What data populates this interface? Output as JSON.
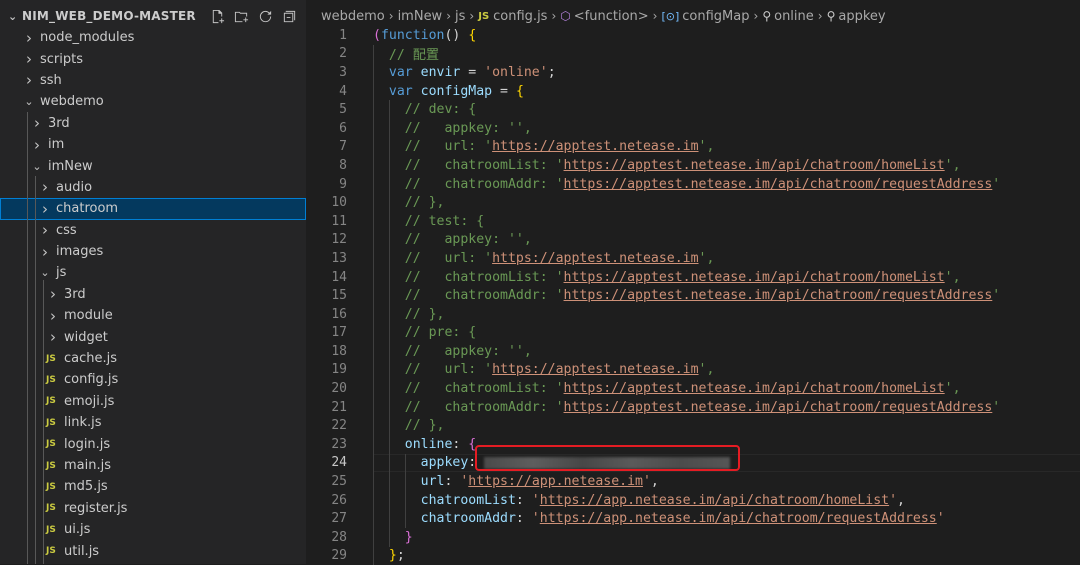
{
  "explorer": {
    "project": "NIM_WEB_DEMO-MASTER",
    "actions": [
      "new-file-icon",
      "new-folder-icon",
      "refresh-icon",
      "collapse-all-icon"
    ],
    "items": [
      {
        "label": "node_modules",
        "type": "folder",
        "expanded": false,
        "depth": 0
      },
      {
        "label": "scripts",
        "type": "folder",
        "expanded": false,
        "depth": 0
      },
      {
        "label": "ssh",
        "type": "folder",
        "expanded": false,
        "depth": 0
      },
      {
        "label": "webdemo",
        "type": "folder",
        "expanded": true,
        "depth": 0
      },
      {
        "label": "3rd",
        "type": "folder",
        "expanded": false,
        "depth": 1
      },
      {
        "label": "im",
        "type": "folder",
        "expanded": false,
        "depth": 1
      },
      {
        "label": "imNew",
        "type": "folder",
        "expanded": true,
        "depth": 1
      },
      {
        "label": "audio",
        "type": "folder",
        "expanded": false,
        "depth": 2
      },
      {
        "label": "chatroom",
        "type": "folder",
        "expanded": false,
        "depth": 2,
        "selected": true
      },
      {
        "label": "css",
        "type": "folder",
        "expanded": false,
        "depth": 2
      },
      {
        "label": "images",
        "type": "folder",
        "expanded": false,
        "depth": 2
      },
      {
        "label": "js",
        "type": "folder",
        "expanded": true,
        "depth": 2
      },
      {
        "label": "3rd",
        "type": "folder",
        "expanded": false,
        "depth": 3
      },
      {
        "label": "module",
        "type": "folder",
        "expanded": false,
        "depth": 3
      },
      {
        "label": "widget",
        "type": "folder",
        "expanded": false,
        "depth": 3
      },
      {
        "label": "cache.js",
        "type": "file",
        "depth": 3
      },
      {
        "label": "config.js",
        "type": "file",
        "depth": 3
      },
      {
        "label": "emoji.js",
        "type": "file",
        "depth": 3
      },
      {
        "label": "link.js",
        "type": "file",
        "depth": 3
      },
      {
        "label": "login.js",
        "type": "file",
        "depth": 3
      },
      {
        "label": "main.js",
        "type": "file",
        "depth": 3
      },
      {
        "label": "md5.js",
        "type": "file",
        "depth": 3
      },
      {
        "label": "register.js",
        "type": "file",
        "depth": 3
      },
      {
        "label": "ui.js",
        "type": "file",
        "depth": 3
      },
      {
        "label": "util.js",
        "type": "file",
        "depth": 3
      }
    ]
  },
  "breadcrumb": {
    "segments": [
      "webdemo",
      "imNew",
      "js",
      "config.js",
      "<function>",
      "configMap",
      "online",
      "appkey"
    ],
    "file_badge": "JS"
  },
  "editor": {
    "current_line": 24,
    "lines": [
      {
        "n": 1,
        "indent": 0,
        "tokens": [
          [
            "brk",
            "("
          ],
          [
            "kw",
            "function"
          ],
          [
            "pun",
            "() "
          ],
          [
            "brk2",
            "{"
          ]
        ]
      },
      {
        "n": 2,
        "indent": 1,
        "tokens": [
          [
            "cm",
            "// 配置"
          ]
        ]
      },
      {
        "n": 3,
        "indent": 1,
        "tokens": [
          [
            "kw",
            "var "
          ],
          [
            "var",
            "envir"
          ],
          [
            "pun",
            " = "
          ],
          [
            "str",
            "'online'"
          ],
          [
            "pun",
            ";"
          ]
        ]
      },
      {
        "n": 4,
        "indent": 1,
        "tokens": [
          [
            "kw",
            "var "
          ],
          [
            "var",
            "configMap"
          ],
          [
            "pun",
            " = "
          ],
          [
            "brk2",
            "{"
          ]
        ]
      },
      {
        "n": 5,
        "indent": 2,
        "tokens": [
          [
            "cm",
            "// dev: {"
          ]
        ]
      },
      {
        "n": 6,
        "indent": 2,
        "tokens": [
          [
            "cm",
            "//   appkey: '',"
          ]
        ]
      },
      {
        "n": 7,
        "indent": 2,
        "tokens": [
          [
            "cm",
            "//   url: '"
          ],
          [
            "cmurl",
            "https://apptest.netease.im"
          ],
          [
            "cm",
            "',"
          ]
        ]
      },
      {
        "n": 8,
        "indent": 2,
        "tokens": [
          [
            "cm",
            "//   chatroomList: '"
          ],
          [
            "cmurl",
            "https://apptest.netease.im/api/chatroom/homeList"
          ],
          [
            "cm",
            "',"
          ]
        ]
      },
      {
        "n": 9,
        "indent": 2,
        "tokens": [
          [
            "cm",
            "//   chatroomAddr: '"
          ],
          [
            "cmurl",
            "https://apptest.netease.im/api/chatroom/requestAddress"
          ],
          [
            "cm",
            "'"
          ]
        ]
      },
      {
        "n": 10,
        "indent": 2,
        "tokens": [
          [
            "cm",
            "// },"
          ]
        ]
      },
      {
        "n": 11,
        "indent": 2,
        "tokens": [
          [
            "cm",
            "// test: {"
          ]
        ]
      },
      {
        "n": 12,
        "indent": 2,
        "tokens": [
          [
            "cm",
            "//   appkey: '',"
          ]
        ]
      },
      {
        "n": 13,
        "indent": 2,
        "tokens": [
          [
            "cm",
            "//   url: '"
          ],
          [
            "cmurl",
            "https://apptest.netease.im"
          ],
          [
            "cm",
            "',"
          ]
        ]
      },
      {
        "n": 14,
        "indent": 2,
        "tokens": [
          [
            "cm",
            "//   chatroomList: '"
          ],
          [
            "cmurl",
            "https://apptest.netease.im/api/chatroom/homeList"
          ],
          [
            "cm",
            "',"
          ]
        ]
      },
      {
        "n": 15,
        "indent": 2,
        "tokens": [
          [
            "cm",
            "//   chatroomAddr: '"
          ],
          [
            "cmurl",
            "https://apptest.netease.im/api/chatroom/requestAddress"
          ],
          [
            "cm",
            "'"
          ]
        ]
      },
      {
        "n": 16,
        "indent": 2,
        "tokens": [
          [
            "cm",
            "// },"
          ]
        ]
      },
      {
        "n": 17,
        "indent": 2,
        "tokens": [
          [
            "cm",
            "// pre: {"
          ]
        ]
      },
      {
        "n": 18,
        "indent": 2,
        "tokens": [
          [
            "cm",
            "//   appkey: '',"
          ]
        ]
      },
      {
        "n": 19,
        "indent": 2,
        "tokens": [
          [
            "cm",
            "//   url: '"
          ],
          [
            "cmurl",
            "https://apptest.netease.im"
          ],
          [
            "cm",
            "',"
          ]
        ]
      },
      {
        "n": 20,
        "indent": 2,
        "tokens": [
          [
            "cm",
            "//   chatroomList: '"
          ],
          [
            "cmurl",
            "https://apptest.netease.im/api/chatroom/homeList"
          ],
          [
            "cm",
            "',"
          ]
        ]
      },
      {
        "n": 21,
        "indent": 2,
        "tokens": [
          [
            "cm",
            "//   chatroomAddr: '"
          ],
          [
            "cmurl",
            "https://apptest.netease.im/api/chatroom/requestAddress"
          ],
          [
            "cm",
            "'"
          ]
        ]
      },
      {
        "n": 22,
        "indent": 2,
        "tokens": [
          [
            "cm",
            "// },"
          ]
        ]
      },
      {
        "n": 23,
        "indent": 2,
        "tokens": [
          [
            "var",
            "online"
          ],
          [
            "pun",
            ": "
          ],
          [
            "brk",
            "{"
          ]
        ]
      },
      {
        "n": 24,
        "indent": 3,
        "tokens": [
          [
            "var",
            "appkey"
          ],
          [
            "pun",
            ":"
          ],
          [
            "blur",
            ""
          ]
        ]
      },
      {
        "n": 25,
        "indent": 3,
        "tokens": [
          [
            "var",
            "url"
          ],
          [
            "pun",
            ": "
          ],
          [
            "str",
            "'"
          ],
          [
            "url",
            "https://app.netease.im"
          ],
          [
            "str",
            "'"
          ],
          [
            "pun",
            ","
          ]
        ]
      },
      {
        "n": 26,
        "indent": 3,
        "tokens": [
          [
            "var",
            "chatroomList"
          ],
          [
            "pun",
            ": "
          ],
          [
            "str",
            "'"
          ],
          [
            "url",
            "https://app.netease.im/api/chatroom/homeList"
          ],
          [
            "str",
            "'"
          ],
          [
            "pun",
            ","
          ]
        ]
      },
      {
        "n": 27,
        "indent": 3,
        "tokens": [
          [
            "var",
            "chatroomAddr"
          ],
          [
            "pun",
            ": "
          ],
          [
            "str",
            "'"
          ],
          [
            "url",
            "https://app.netease.im/api/chatroom/requestAddress"
          ],
          [
            "str",
            "'"
          ]
        ]
      },
      {
        "n": 28,
        "indent": 2,
        "tokens": [
          [
            "brk",
            "}"
          ]
        ]
      },
      {
        "n": 29,
        "indent": 1,
        "tokens": [
          [
            "brk2",
            "}"
          ],
          [
            "pun",
            ";"
          ]
        ]
      }
    ]
  },
  "annotation": {
    "color": "#e51c23",
    "target": "appkey-value-redacted"
  }
}
